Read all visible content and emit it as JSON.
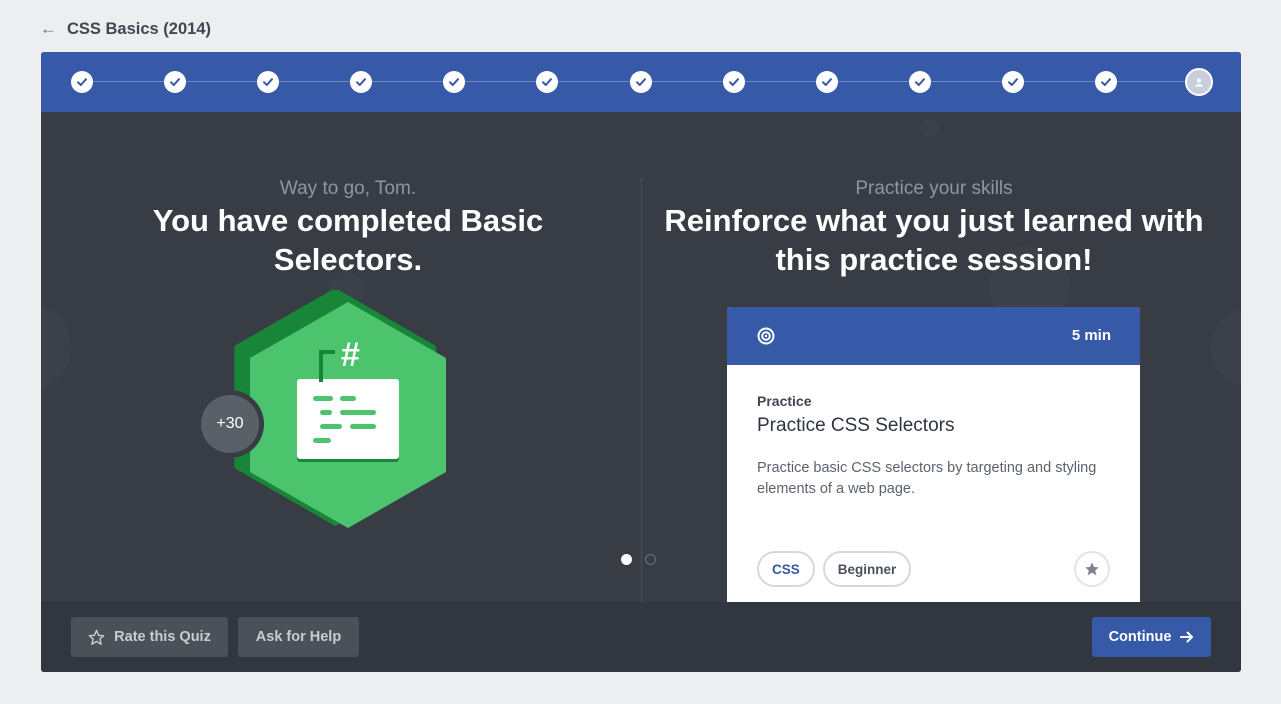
{
  "header": {
    "back_icon": "arrow-left-icon",
    "course_title": "CSS Basics (2014)"
  },
  "progress": {
    "completed_steps": 12,
    "current_step": 13,
    "total_steps": 13,
    "completed_icon": "check-icon",
    "current_icon": "avatar-icon"
  },
  "left": {
    "subtitle": "Way to go, Tom.",
    "title": "You have completed Basic Selectors.",
    "points": "+30",
    "badge_icon": "css-selector-badge-icon"
  },
  "right": {
    "subtitle": "Practice your skills",
    "title": "Reinforce what you just learned with this practice session!"
  },
  "practice_card": {
    "icon": "target-icon",
    "duration": "5 min",
    "kind": "Practice",
    "title": "Practice CSS Selectors",
    "description": "Practice basic CSS selectors by targeting and styling elements of a web page.",
    "tags": [
      "CSS",
      "Beginner"
    ],
    "favorite_icon": "star-icon"
  },
  "pagination": {
    "active": 1,
    "total": 2
  },
  "footer": {
    "rate_label": "Rate this Quiz",
    "help_label": "Ask for Help",
    "continue_label": "Continue"
  },
  "colors": {
    "accent": "#3659a8",
    "badge_green": "#4cc36d",
    "badge_dark_green": "#188538",
    "panel": "#383d45",
    "footer": "#32363e"
  }
}
